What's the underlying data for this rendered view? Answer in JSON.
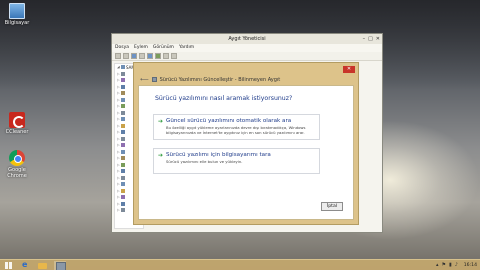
{
  "desktop": {
    "icons": [
      {
        "label": "Bilgisayar",
        "icon": "computer-icon"
      },
      {
        "label": "CCleaner",
        "icon": "ccleaner-icon"
      },
      {
        "label": "Google Chrome",
        "icon": "chrome-icon"
      }
    ]
  },
  "device_manager": {
    "title": "Aygıt Yöneticisi",
    "menu": [
      "Dosya",
      "Eylem",
      "Görünüm",
      "Yardım"
    ],
    "tree_root": "SAM"
  },
  "wizard": {
    "title": "Sürücü Yazılımını Güncelleştir - Bilinmeyen Aygıt",
    "question": "Sürücü yazılımını nasıl aramak istiyorsunuz?",
    "option1": {
      "title": "Güncel sürücü yazılımını otomatik olarak ara",
      "description": "Bu özelliği aygıt yükleme ayarlarınızda devre dışı bırakmadıkça, Windows bilgisayarınızda ve İnternet'te aygıtınız için en son sürücü yazılımını arar."
    },
    "option2": {
      "title": "Sürücü yazılımı için bilgisayarımı tara",
      "description": "Sürücü yazılımını elle bulun ve yükleyin."
    },
    "cancel_label": "İptal",
    "close_label": "✕"
  },
  "taskbar": {
    "clock": "16:14"
  }
}
